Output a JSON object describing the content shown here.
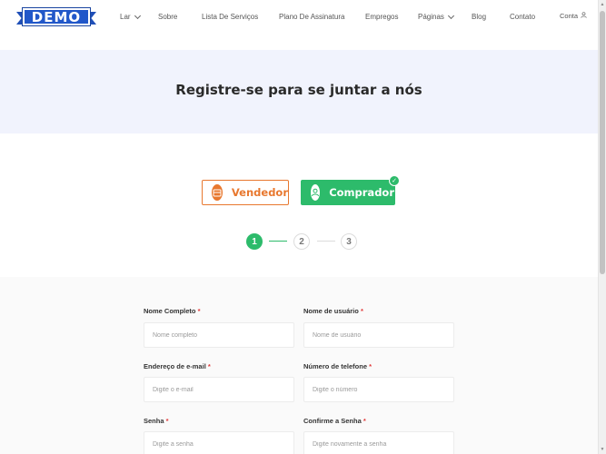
{
  "logo": {
    "text": "DEMO"
  },
  "nav": {
    "home": "Lar",
    "about": "Sobre",
    "services": "Lista De Serviços",
    "plans": "Plano De Assinatura",
    "jobs": "Empregos",
    "pages": "Páginas",
    "blog": "Blog",
    "contact": "Contato",
    "account": "Conta"
  },
  "banner": {
    "title": "Registre-se para se juntar a nós"
  },
  "roles": {
    "seller": "Vendedor",
    "buyer": "Comprador",
    "selected": "buyer"
  },
  "steps": [
    "1",
    "2",
    "3"
  ],
  "form": {
    "required_mark": "*",
    "full_name": {
      "label": "Nome Completo",
      "placeholder": "Nome completo"
    },
    "username": {
      "label": "Nome de usuário",
      "placeholder": "Nome de usuário"
    },
    "email": {
      "label": "Endereço de e-mail",
      "placeholder": "Digite o e-mail"
    },
    "phone": {
      "label": "Número de telefone",
      "placeholder": "Digite o número"
    },
    "password": {
      "label": "Senha",
      "placeholder": "Digite a senha"
    },
    "confirm_password": {
      "label": "Confirme a Senha",
      "placeholder": "Digite novamente a senha"
    }
  },
  "colors": {
    "accent_green": "#2dbb6b",
    "accent_orange": "#e8782f",
    "logo_blue": "#2157c9",
    "banner_bg": "#f1f3fd",
    "required_red": "#e23b3b"
  }
}
